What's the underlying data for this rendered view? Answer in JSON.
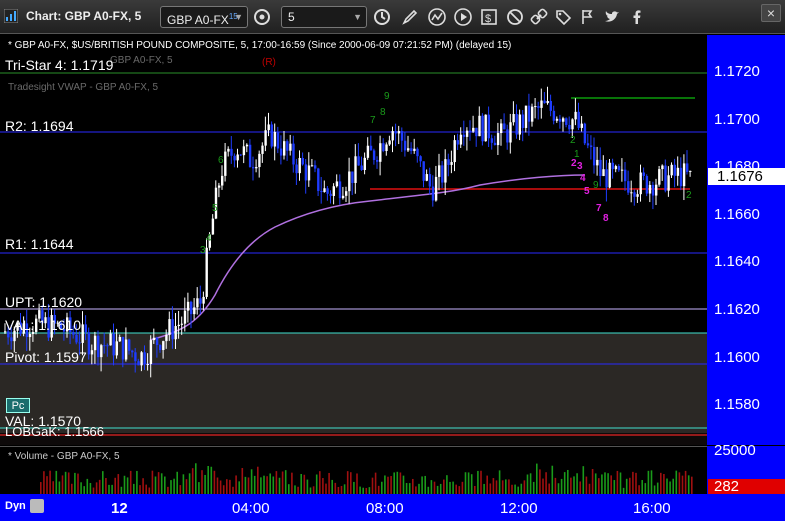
{
  "window": {
    "title": "Chart: GBP A0-FX, 5"
  },
  "toolbar": {
    "symbol": "GBP A0-FX",
    "symbol_superscript": "15",
    "interval": "5",
    "close_label": "×"
  },
  "chart": {
    "info_line": "* GBP A0-FX, $US/BRITISH POUND COMPOSITE, 5, 17:00-16:59 (Since 2000-06-09 07:21:52 PM) (delayed 15)",
    "ghost_labels": [
      "GBP A0-FX, 5",
      "Tradesight VWAP - GBP A0-FX, 5"
    ],
    "restricted_label": "(R)",
    "levels": [
      {
        "label": "Tri-Star 4: 1.1719"
      },
      {
        "label": "R2: 1.1694"
      },
      {
        "label": "R1: 1.1644"
      },
      {
        "label": "UPT: 1.1620"
      },
      {
        "label": "VAL: 1.1610"
      },
      {
        "label": "Pivot: 1.1597"
      },
      {
        "label": "VAL: 1.1570"
      },
      {
        "label": "LOBGaK: 1.1566"
      }
    ],
    "pc_button": "Pc",
    "last_price": "1.1676",
    "price_ticks": [
      "1.1720",
      "1.1700",
      "1.1680",
      "1.1660",
      "1.1640",
      "1.1620",
      "1.1600",
      "1.1580"
    ],
    "annotations": {
      "green": [
        "9",
        "8",
        "7",
        "6",
        "5",
        "4",
        "3",
        "2",
        "1",
        "9",
        "2"
      ],
      "magenta": [
        "2",
        "3",
        "4",
        "5",
        "7",
        "8"
      ]
    }
  },
  "volume": {
    "title": "* Volume - GBP A0-FX, 5",
    "axis_label": "25000",
    "last_value": "282"
  },
  "time_axis": {
    "dyn_label": "Dyn",
    "ticks": [
      "12",
      "04:00",
      "08:00",
      "12:00",
      "16:00"
    ]
  },
  "colors": {
    "background": "#000000",
    "axis_blue": "#0000ff",
    "level_blue": "#2a2aff",
    "tristar_green": "#2a8f2a",
    "vwap": "#b070e0",
    "up_candle": "#ffffff",
    "down_candle": "#1e3cff",
    "volume_bar": "#1a9a1a",
    "volume_bar_red": "#a01010"
  }
}
